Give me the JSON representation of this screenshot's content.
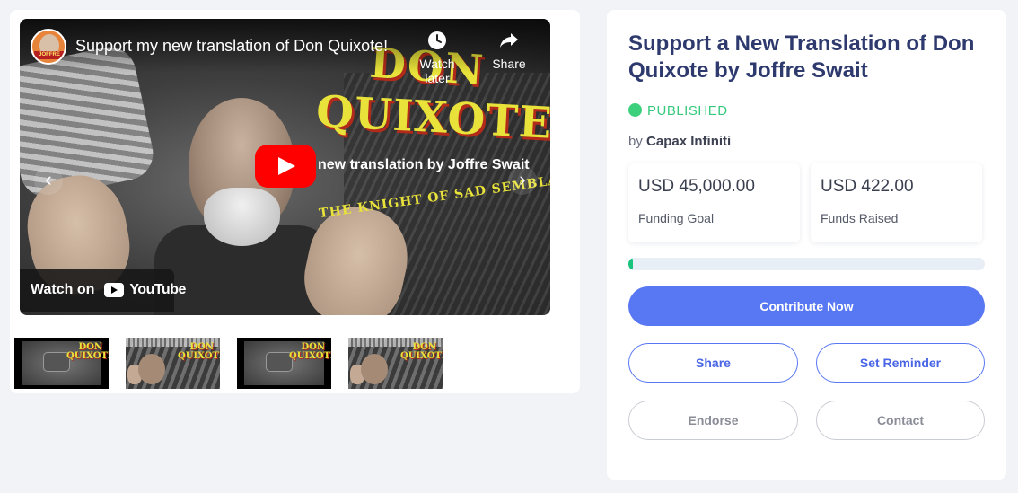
{
  "video": {
    "title": "Support my new translation of Don Quixote!",
    "channel_badge": "JOFFRE",
    "watch_later": "Watch later",
    "share": "Share",
    "overlay_don": "DON",
    "overlay_quixote": "QUIXOTE",
    "overlay_subtitle": "new translation by Joffre Swait",
    "overlay_tagline": "THE KNIGHT OF SAD SEMBLANCE",
    "watch_on": "Watch on",
    "youtube": "YouTube",
    "prev_arrow": "‹",
    "next_arrow": "›"
  },
  "thumbnails": [
    {
      "type": "video",
      "text": "DON QUIXOTE"
    },
    {
      "type": "image",
      "text": "DON QUIXOTE"
    },
    {
      "type": "video",
      "text": "DON QUIXOTE"
    },
    {
      "type": "image",
      "text": "DON QUIXOTE"
    }
  ],
  "campaign": {
    "title": "Support a New Translation of Don Quixote by Joffre Swait",
    "status": "PUBLISHED",
    "by_prefix": "by",
    "author": "Capax Infiniti",
    "funding_goal_amount": "USD 45,000.00",
    "funding_goal_label": "Funding Goal",
    "funds_raised_amount": "USD 422.00",
    "funds_raised_label": "Funds Raised",
    "progress_percent": 0.94
  },
  "actions": {
    "contribute": "Contribute Now",
    "share": "Share",
    "reminder": "Set Reminder",
    "endorse": "Endorse",
    "contact": "Contact"
  },
  "colors": {
    "primary": "#5877f2",
    "title": "#2e3a6e",
    "status_green": "#3ccf7c",
    "progress_green": "#19c37d",
    "youtube_red": "#ff0000"
  }
}
